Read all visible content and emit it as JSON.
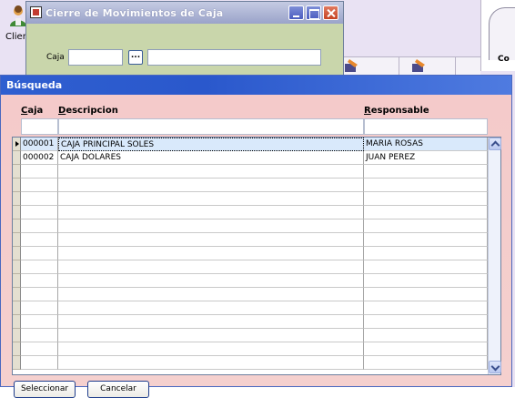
{
  "background_app": {
    "user_label": "Clier",
    "right_label": "Co"
  },
  "cierre_window": {
    "title": "Cierre de Movimientos de Caja",
    "caja_label": "Caja",
    "lookup_button": "...",
    "caja_code_value": "",
    "caja_desc_value": ""
  },
  "busqueda": {
    "title": "Búsqueda",
    "columns": {
      "caja": {
        "first": "C",
        "rest": "aja"
      },
      "descripcion": {
        "first": "D",
        "rest": "escripcion"
      },
      "responsable": {
        "first": "R",
        "rest": "esponsable"
      }
    },
    "rows": [
      {
        "caja": "000001",
        "descripcion": "CAJA PRINCIPAL SOLES",
        "responsable": "MARIA ROSAS",
        "selected": true
      },
      {
        "caja": "000002",
        "descripcion": "CAJA DOLARES",
        "responsable": "JUAN PEREZ",
        "selected": false
      }
    ],
    "buttons": {
      "seleccionar": "Seleccionar",
      "cancelar": "Cancelar"
    }
  },
  "colors": {
    "busqueda_title_bg": "#2f5fd0",
    "busqueda_body_bg": "#f4caca",
    "cierre_body_bg": "#c9d6ab",
    "selected_row_bg": "#d9e9fb"
  }
}
